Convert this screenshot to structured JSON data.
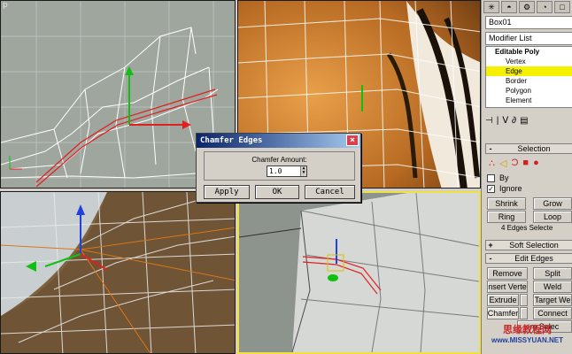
{
  "viewports": {
    "top_left": {
      "label": "p"
    },
    "bottom_left": {
      "label": "ft"
    }
  },
  "panel": {
    "tabs": [
      "create-icon",
      "modify-icon",
      "hierarchy-icon",
      "motion-icon",
      "display-icon",
      "utilities-icon"
    ],
    "tab_glyphs": [
      "✳",
      "◓",
      "⚙",
      "◔",
      "□",
      "⚒"
    ],
    "object_name": "Box01",
    "modifier_list": "Modifier List",
    "stack": {
      "top": "Editable Poly",
      "items": [
        "Vertex",
        "Edge",
        "Border",
        "Polygon",
        "Element"
      ],
      "selected": "Edge"
    },
    "toolbar_glyphs": [
      "⊣",
      "|",
      "Ⅴ",
      "∂",
      "▤"
    ],
    "selection": {
      "title": "Selection",
      "by_label": "By",
      "ignore_label": "Ignore",
      "shrink": "Shrink",
      "grow": "Grow",
      "ring": "Ring",
      "loop": "Loop",
      "status": "4 Edges Selecte"
    },
    "soft_selection": {
      "title": "Soft Selection"
    },
    "edit_edges": {
      "title": "Edit Edges",
      "remove": "Remove",
      "split": "Split",
      "insert_vertex": "nsert Verte",
      "weld": "Weld",
      "extrude": "Extrude",
      "target_weld": "Target We",
      "chamfer": "Chamfer",
      "connect": "Connect",
      "m_select": "m Selec"
    }
  },
  "dialog": {
    "title": "Chamfer Edges",
    "group_label": "Chamfer Amount:",
    "amount": "1.0",
    "apply": "Apply",
    "ok": "OK",
    "cancel": "Cancel",
    "close": "×"
  },
  "watermark": {
    "line1": "思缘教程网",
    "line2": "www.MISSYUAN.NET"
  },
  "colors": {
    "viewport_gray": "#9ea69e",
    "highlight_yellow": "#f4f000",
    "selected_edge_red": "#e02020",
    "title_blue": "#0a246a"
  }
}
